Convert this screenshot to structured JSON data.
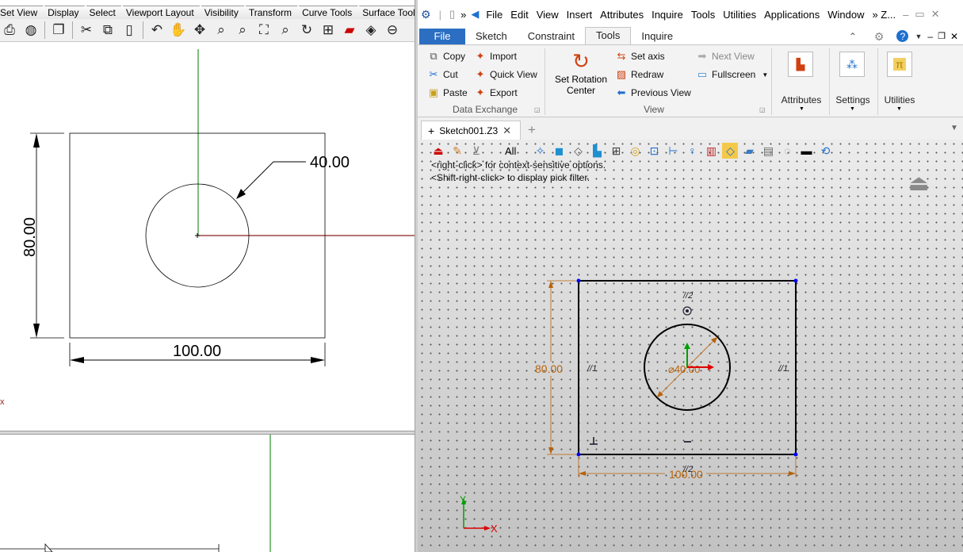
{
  "left_app": {
    "tabs": [
      "Set View",
      "Display",
      "Select",
      "Viewport Layout",
      "Visibility",
      "Transform",
      "Curve Tools",
      "Surface Tools"
    ],
    "toolbar_icons": [
      "print-icon",
      "globe-icon",
      "new-document-icon",
      "cut-icon",
      "copy-icon",
      "paste-icon",
      "undo-icon",
      "pan-hand-icon",
      "rotate-view-icon",
      "zoom-icon",
      "zoom-window-icon",
      "zoom-extents-icon",
      "zoom-selected-icon",
      "rotate-zoom-icon",
      "viewport-grid-icon",
      "car-shaded-icon",
      "render-icon",
      "circle-icon"
    ],
    "drawing": {
      "diameter_label": "40.00",
      "height_label": "80.00",
      "width_label": "100.00",
      "marker": "x"
    }
  },
  "right_app": {
    "menu": [
      "File",
      "Edit",
      "View",
      "Insert",
      "Attributes",
      "Inquire",
      "Tools",
      "Utilities",
      "Applications",
      "Window",
      "» Z..."
    ],
    "ribbon_tabs": [
      "File",
      "Sketch",
      "Constraint",
      "Tools",
      "Inquire"
    ],
    "active_tab": "Tools",
    "ribbon": {
      "copy": "Copy",
      "cut": "Cut",
      "paste": "Paste",
      "import": "Import",
      "quick_view": "Quick View",
      "export": "Export",
      "data_exchange_label": "Data Exchange",
      "set_rotation_center": "Set Rotation Center",
      "set_axis": "Set axis",
      "redraw": "Redraw",
      "previous_view": "Previous View",
      "next_view": "Next View",
      "fullscreen": "Fullscreen",
      "view_label": "View",
      "attributes": "Attributes",
      "settings": "Settings",
      "utilities": "Utilities"
    },
    "document_tab": "Sketch001.Z3",
    "filter_label": "All",
    "hints": [
      "<right-click> for context-sensitive options.",
      "<Shift-right-click> to display pick filter."
    ],
    "sketch": {
      "height_label": "80.00",
      "width_label": "100.00",
      "diameter_label": "⌀40.00",
      "constraint_top": "//2",
      "constraint_left": "//1",
      "constraint_right": "//1",
      "constraint_bottom": "//2",
      "axis_x": "X",
      "axis_y": "Y"
    },
    "colors": {
      "file_tab": "#2b6ec2",
      "dimension": "#b8620a",
      "sketch_line": "#000000",
      "vertex": "#0000ff",
      "axis_green": "#00a000",
      "axis_red": "#e00000"
    }
  }
}
